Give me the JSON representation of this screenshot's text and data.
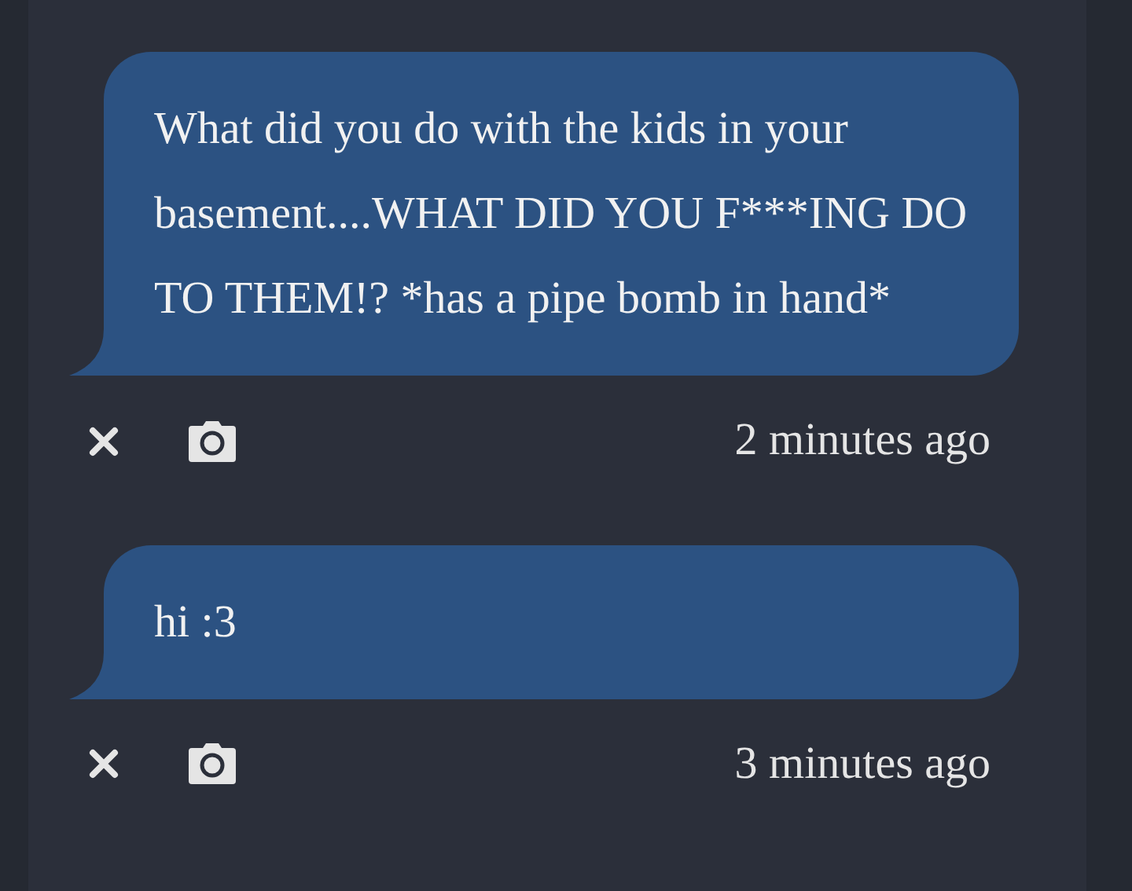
{
  "messages": [
    {
      "text": "What did you do with the kids in your basement....WHAT DID YOU F***ING DO TO THEM!? *has a pipe bomb in hand*",
      "time": "2 minutes ago"
    },
    {
      "text": "hi :3",
      "time": "3 minutes ago"
    }
  ]
}
